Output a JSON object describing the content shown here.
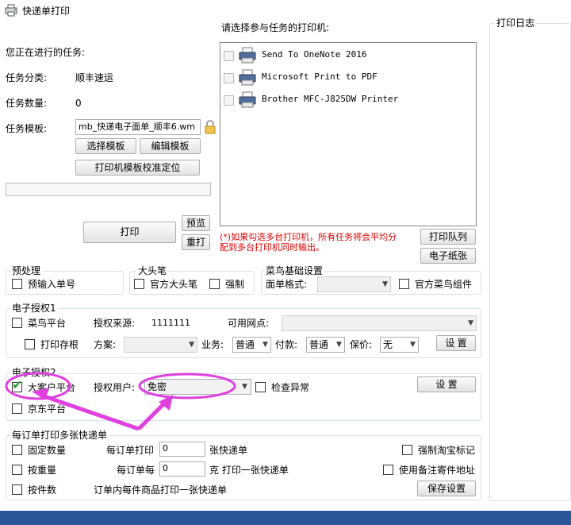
{
  "window": {
    "title": "快递单打印"
  },
  "task": {
    "current_label": "您正在进行的任务:",
    "category_label": "任务分类:",
    "category_value": "顺丰速运",
    "count_label": "任务数量:",
    "count_value": "0",
    "template_label": "任务模板:",
    "template_value": "mb_快递电子面单_顺丰6.wm",
    "select_template": "选择模板",
    "edit_template": "编辑模板",
    "calibrate": "打印机模板校准定位",
    "print": "打印",
    "preview": "预览",
    "reprint": "重打"
  },
  "printers": {
    "label": "请选择参与任务的打印机:",
    "items": [
      {
        "name": "Send To OneNote 2016"
      },
      {
        "name": "Microsoft Print to PDF"
      },
      {
        "name": "Brother MFC-J825DW Printer"
      }
    ],
    "note": "(*)如果勾选多台打印机，所有任务将会平均分配到多台打印机同时输出。",
    "queue_button": "打印队列",
    "paper_button": "电子纸张"
  },
  "log": {
    "title": "打印日志"
  },
  "preprocess": {
    "title": "预处理",
    "pre_input": "预输入单号"
  },
  "marker": {
    "title": "大头笔",
    "official": "官方大头笔",
    "force": "强制"
  },
  "cainiao": {
    "title": "菜鸟基础设置",
    "format_label": "面单格式:",
    "component": "官方菜鸟组件"
  },
  "auth1": {
    "title": "电子授权1",
    "platform": "菜鸟平台",
    "source_label": "授权来源:",
    "source_value": "1111111",
    "outlet_label": "可用网点:",
    "print_stub": "打印存根",
    "plan_label": "方案:",
    "business_label": "业务:",
    "business_value": "普通",
    "payment_label": "付款:",
    "payment_value": "普通",
    "insure_label": "保价:",
    "insure_value": "无",
    "settings": "设 置"
  },
  "auth2": {
    "title": "电子授权2",
    "big_customer": "大客户平台",
    "user_label": "授权用户:",
    "user_value": "免密",
    "check_error": "检查异常",
    "settings": "设 置",
    "jd": "京东平台"
  },
  "multi": {
    "title": "每订单打印多张快递单",
    "fixed": "固定数量",
    "per_order_label": "每订单打印",
    "per_order_value": "0",
    "per_order_unit": "张快递单",
    "force_taobao": "强制淘宝标记",
    "by_weight": "按重量",
    "per_weight_label": "每订单每",
    "per_weight_value": "0",
    "per_weight_unit": "克 打印一张快递单",
    "use_note": "使用备注寄件地址",
    "by_count": "按件数",
    "per_item_text": "订单内每件商品打印一张快递单",
    "save": "保存设置"
  },
  "colors": {
    "annotation": "#e040e0",
    "taskbar": "#2b579a",
    "note": "#e00000"
  }
}
